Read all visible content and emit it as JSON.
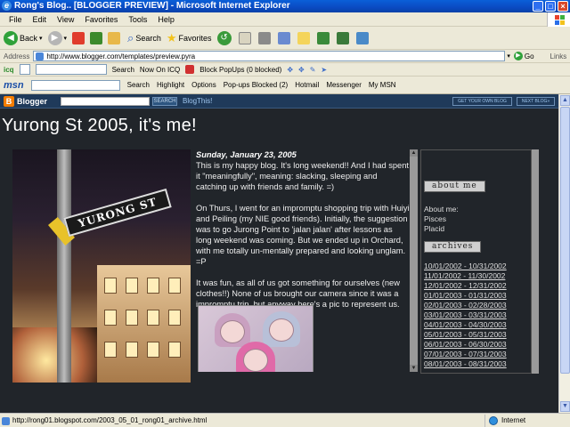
{
  "window": {
    "title": "Rong's Blog.. [BLOGGER PREVIEW] - Microsoft Internet Explorer"
  },
  "menu": [
    "File",
    "Edit",
    "View",
    "Favorites",
    "Tools",
    "Help"
  ],
  "toolbar": {
    "back": "Back",
    "search": "Search",
    "favorites": "Favorites"
  },
  "address": {
    "label": "Address",
    "url": "http://www.blogger.com/templates/preview.pyra",
    "go": "Go",
    "links": "Links"
  },
  "icq": {
    "label": "icq",
    "search": "Search",
    "now_on_icq": "Now On ICQ",
    "block_popups": "Block PopUps (0 blocked)"
  },
  "msn": {
    "logo": "msn",
    "search": "Search",
    "highlight": "Highlight",
    "options": "Options",
    "popups": "Pop-ups Blocked (2)",
    "hotmail": "Hotmail",
    "messenger": "Messenger",
    "mymsn": "My MSN"
  },
  "blogger": {
    "logo": "Blogger",
    "search_btn": "SEARCH",
    "blog_this": "BlogThis!",
    "get_own": "GET YOUR OWN BLOG",
    "next": "NEXT BLOG»"
  },
  "blog": {
    "title": "Yurong St 2005, it's me!",
    "photo_sign": "YURONG ST",
    "post": {
      "date": "Sunday, January 23, 2005",
      "p1": "This is my happy blog. It's long weekend!! And I had spent it \"meaningfully\", meaning: slacking, sleeping and catching up with friends and family. =)",
      "p2": "On Thurs, I went for an impromptu shopping trip with Huiyi and Peiling (my NIE good friends). Initially, the suggestion was to go Jurong Point to 'jalan jalan' after lessons as long weekend was coming. But we ended up in Orchard, with me totally un-mentally prepared and looking unglam. =P",
      "p3": "It was fun, as all of us got something for ourselves (new clothes!!) None of us brought our camera since it was a impromptu trip, but anyway here's a pic to represent us."
    },
    "sidebar": {
      "about_header": "about me",
      "about_label": "About me:",
      "about_items": [
        "Pisces",
        "Placid"
      ],
      "archives_header": "archives",
      "archives": [
        "10/01/2002 - 10/31/2002",
        "11/01/2002 - 11/30/2002",
        "12/01/2002 - 12/31/2002",
        "01/01/2003 - 01/31/2003",
        "02/01/2003 - 02/28/2003",
        "03/01/2003 - 03/31/2003",
        "04/01/2003 - 04/30/2003",
        "05/01/2003 - 05/31/2003",
        "06/01/2003 - 06/30/2003",
        "07/01/2003 - 07/31/2003",
        "08/01/2003 - 08/31/2003"
      ]
    }
  },
  "status": {
    "url": "http://rong01.blogspot.com/2003_05_01_rong01_archive.html",
    "zone": "Internet"
  }
}
